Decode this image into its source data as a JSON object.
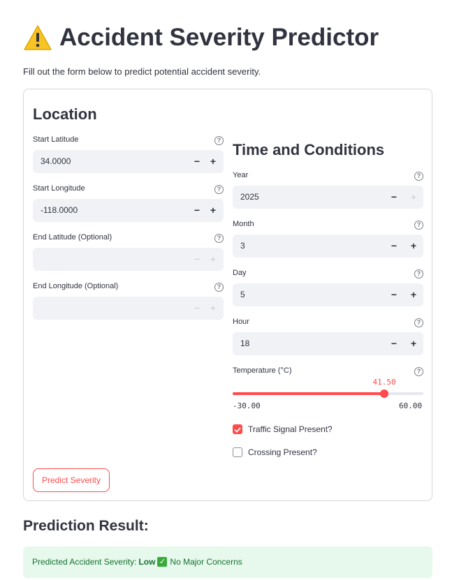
{
  "header": {
    "title": "Accident Severity Predictor",
    "subtitle": "Fill out the form below to predict potential accident severity."
  },
  "location": {
    "title": "Location",
    "start_lat": {
      "label": "Start Latitude",
      "value": "34.0000"
    },
    "start_lon": {
      "label": "Start Longitude",
      "value": "-118.0000"
    },
    "end_lat": {
      "label": "End Latitude (Optional)",
      "value": ""
    },
    "end_lon": {
      "label": "End Longitude (Optional)",
      "value": ""
    }
  },
  "conditions": {
    "title": "Time and Conditions",
    "year": {
      "label": "Year",
      "value": "2025"
    },
    "month": {
      "label": "Month",
      "value": "3"
    },
    "day": {
      "label": "Day",
      "value": "5"
    },
    "hour": {
      "label": "Hour",
      "value": "18"
    },
    "temperature": {
      "label": "Temperature (°C)",
      "value": "41.50",
      "min": "-30.00",
      "max": "60.00",
      "fraction": 0.7944
    },
    "traffic_signal": {
      "label": "Traffic Signal Present?",
      "checked": true
    },
    "crossing": {
      "label": "Crossing Present?",
      "checked": false
    }
  },
  "actions": {
    "predict_label": "Predict Severity"
  },
  "result": {
    "title": "Prediction Result:",
    "prefix": "Predicted Accident Severity:",
    "severity": "Low",
    "note": "No Major Concerns"
  },
  "icons": {
    "help": "?",
    "minus": "−",
    "plus": "+",
    "check": "✓"
  },
  "colors": {
    "accent": "#ff4b4b",
    "success_bg": "#e6f9ec",
    "success_text": "#177233"
  }
}
